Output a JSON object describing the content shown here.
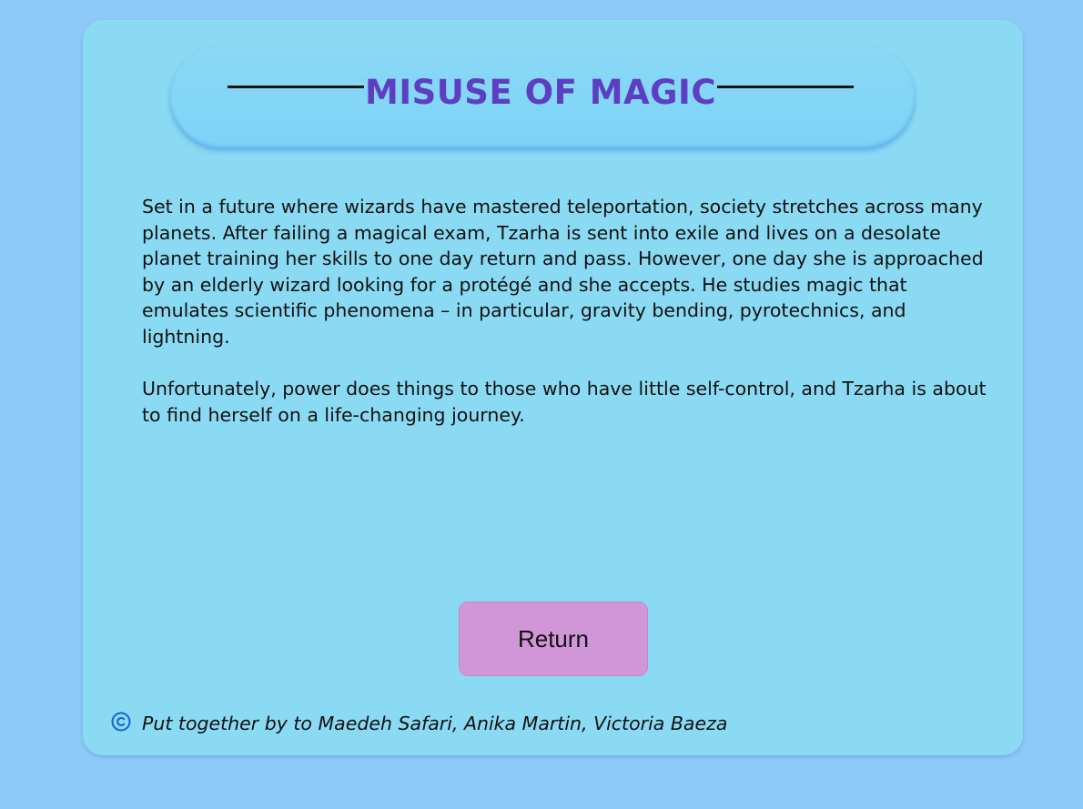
{
  "header": {
    "title": "MISUSE OF MAGIC"
  },
  "description": {
    "paragraphs": [
      "Set in a future where wizards have mastered teleportation, society stretches across many planets. After failing a magical exam, Tzarha is sent into exile and lives on a desolate planet training her skills to one day return and pass. However, one day she is approached by an elderly wizard looking for a protégé and she accepts. He studies magic that emulates scientific phenomena – in particular, gravity bending, pyrotechnics, and lightning.",
      "Unfortunately, power does things to those who have little self-control, and Tzarha is about to find herself on a life-changing journey."
    ]
  },
  "actions": {
    "return_label": "Return"
  },
  "footer": {
    "icon": "copyright-icon",
    "credits": "Put together by to Maedeh Safari, Anika Martin, Victoria Baeza"
  },
  "colors": {
    "page_background": "#8ecaf7",
    "card_background": "#8bdaf3",
    "title_color": "#5d3ec2",
    "button_background": "#d196d8",
    "icon_color": "#1a5fd0"
  }
}
